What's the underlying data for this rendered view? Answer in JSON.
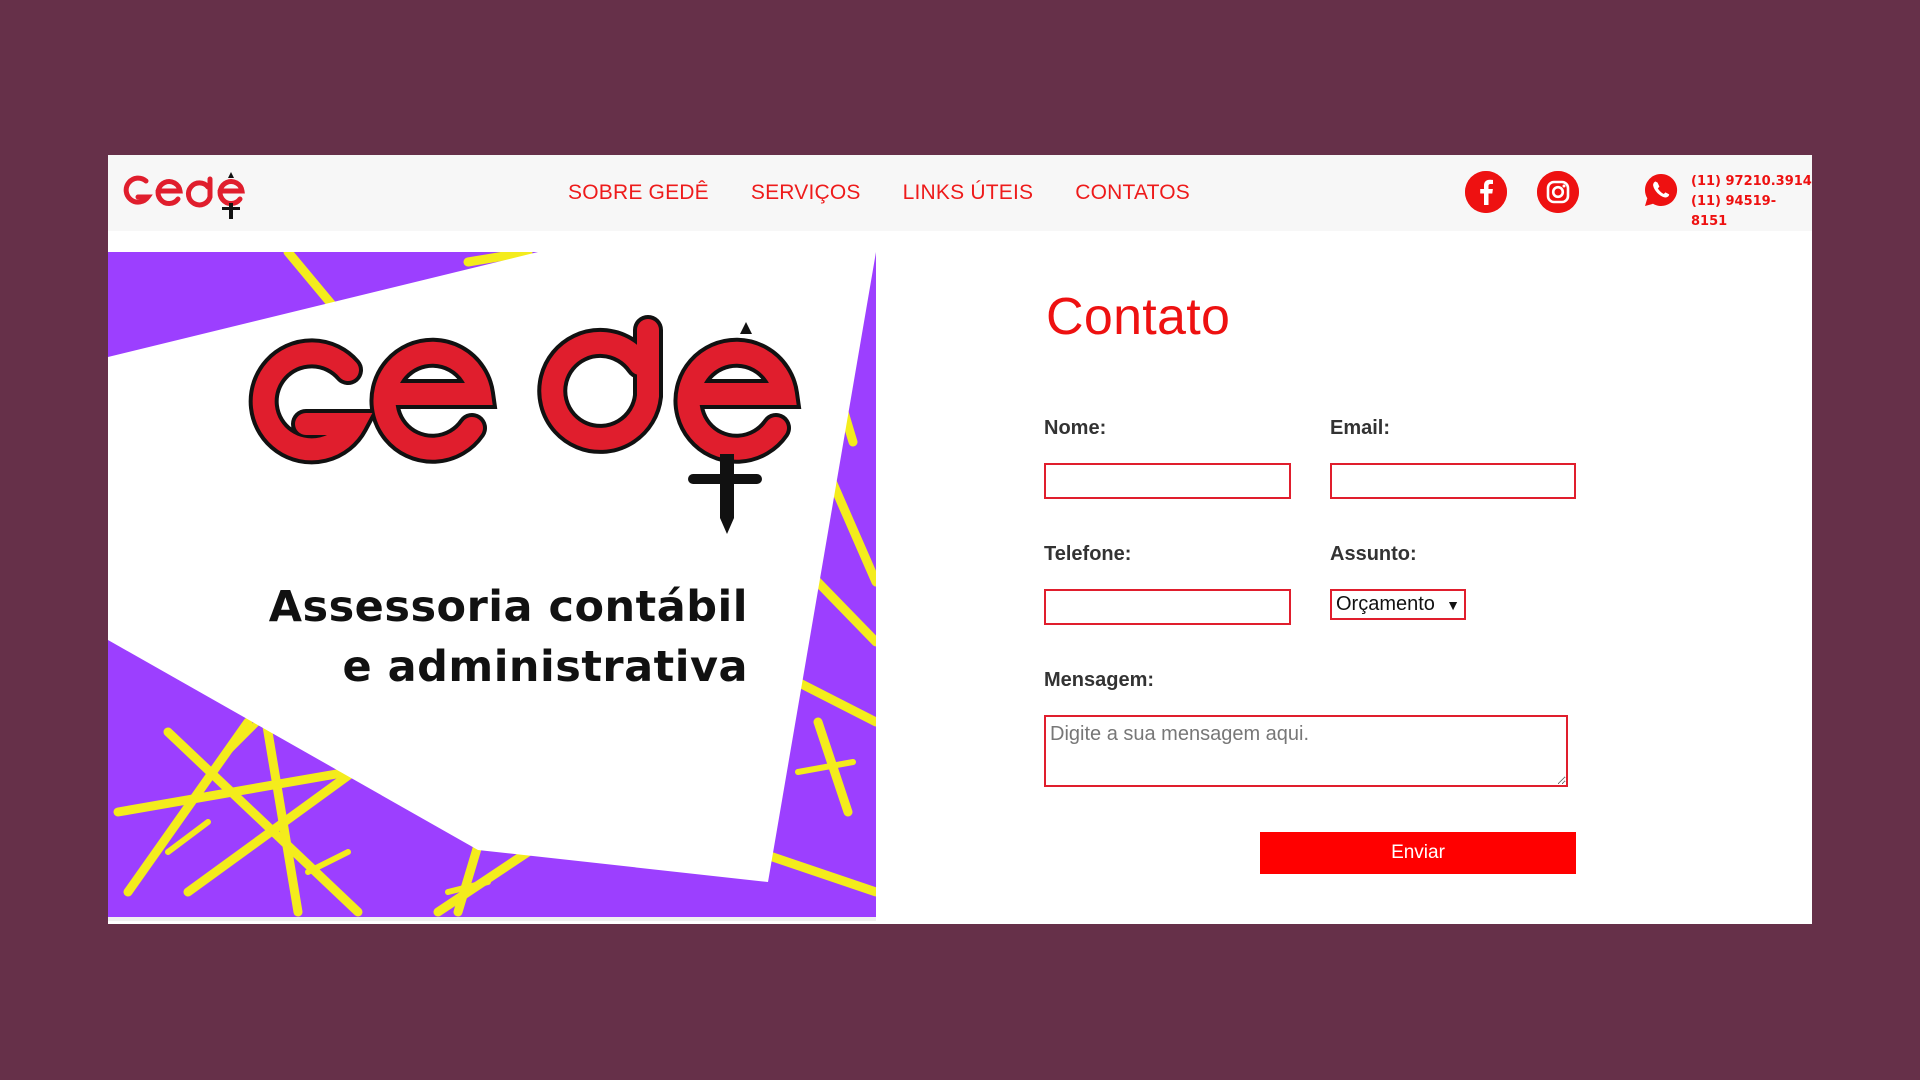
{
  "header": {
    "logo_text": "Gedê",
    "nav": [
      {
        "label": "SOBRE GEDÊ"
      },
      {
        "label": "SERVIÇOS"
      },
      {
        "label": "LINKS ÚTEIS"
      },
      {
        "label": "CONTATOS"
      }
    ],
    "social": [
      {
        "icon": "facebook-icon"
      },
      {
        "icon": "instagram-icon"
      }
    ],
    "phone_icon": "whatsapp-icon",
    "phones": [
      "(11) 97210.3914",
      "(11) 94519-8151"
    ]
  },
  "hero": {
    "logo_text": "Gedê",
    "tagline_line1": "Assessoria contábil",
    "tagline_line2": "e administrativa"
  },
  "form": {
    "title": "Contato",
    "name_label": "Nome:",
    "email_label": "Email:",
    "phone_label": "Telefone:",
    "subject_label": "Assunto:",
    "subject_value": "Orçamento",
    "message_label": "Mensagem:",
    "message_placeholder": "Digite a sua mensagem aqui.",
    "submit_label": "Enviar"
  },
  "colors": {
    "accent": "#ee1111",
    "page_background": "#663049",
    "hero_purple": "#9c3fff",
    "hero_yellow": "#f4ec1c"
  }
}
